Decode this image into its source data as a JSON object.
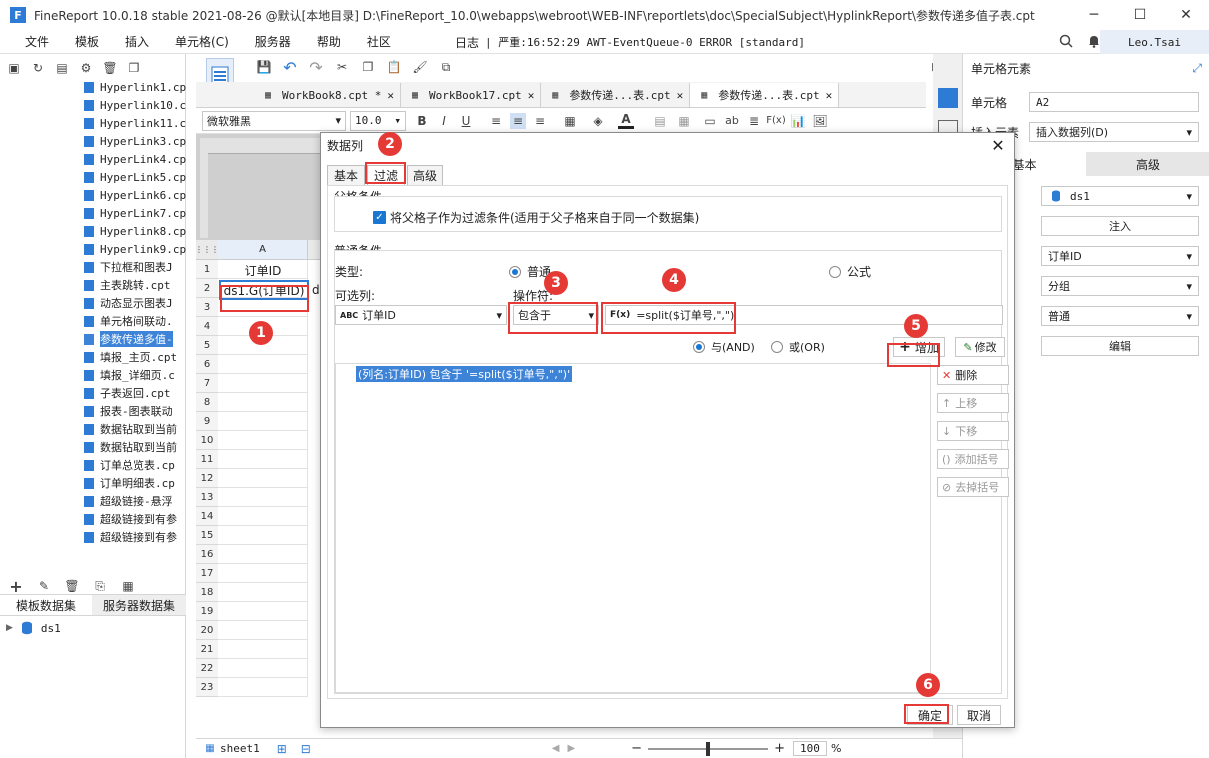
{
  "window": {
    "title": "FineReport 10.0.18 stable 2021-08-26 @默认[本地目录]     D:\\FineReport_10.0\\webapps\\webroot\\WEB-INF\\reportlets\\doc\\SpecialSubject\\HyplinkReport\\参数传递多值子表.cpt",
    "minimize": "─",
    "maximize": "☐",
    "close": "✕"
  },
  "menu": [
    "文件",
    "模板",
    "插入",
    "单元格(C)",
    "服务器",
    "帮助",
    "社区"
  ],
  "log": {
    "label": "日志",
    "text": "| 严重:16:52:29 AWT-EventQueue-0 ERROR [standard]"
  },
  "user": "Leo.Tsai",
  "left_panel": {
    "tree_items": [
      "Hyperlink1.cp",
      "Hyperlink10.c",
      "Hyperlink11.c",
      "HyperLink3.cp",
      "HyperLink4.cp",
      "HyperLink5.cp",
      "HyperLink6.cp",
      "HyperLink7.cp",
      "Hyperlink8.cp",
      "Hyperlink9.cp",
      "下拉框和图表J",
      "主表跳转.cpt",
      "动态显示图表J",
      "单元格间联动.",
      "参数传递多值-",
      "填报_主页.cpt",
      "填报_详细页.c",
      "子表返回.cpt",
      "报表-图表联动",
      "数据钻取到当前",
      "数据钻取到当前",
      "订单总览表.cp",
      "订单明细表.cp",
      "超级链接-悬浮",
      "超级链接到有参",
      "超级链接到有参"
    ],
    "selected_index": 14,
    "dataset_tabs": [
      "模板数据集",
      "服务器数据集"
    ],
    "dataset": "ds1"
  },
  "tabs": [
    "WorkBook8.cpt *",
    "WorkBook17.cpt",
    "参数传递...表.cpt",
    "参数传递...表.cpt"
  ],
  "format_bar": {
    "font": "微软雅黑",
    "size": "10.0"
  },
  "sheet": {
    "col_header": "A",
    "header_cell": "订单ID",
    "formula_cell": "ds1.G(订单ID)",
    "overflow_char": "d",
    "rows": [
      "1",
      "2",
      "3",
      "4",
      "5",
      "6",
      "7",
      "8",
      "9",
      "10",
      "11",
      "12",
      "13",
      "14",
      "15",
      "16",
      "17",
      "18",
      "19",
      "20",
      "21",
      "22",
      "23"
    ],
    "sheet_tab": "sheet1",
    "zoom": "100",
    "zoom_unit": "%",
    "zoom_minus": "−",
    "zoom_plus": "+"
  },
  "right_panel": {
    "title": "单元格元素",
    "cell_label": "单元格",
    "cell_value": "A2",
    "insert_label": "插入元素",
    "insert_value": "插入数据列(D)",
    "tab_basic": "基本",
    "tab_advanced": "高级",
    "dataset_value": "ds1",
    "inject_button": "注入",
    "column_value": "订单ID",
    "group_value": "分组",
    "normal_value": "普通",
    "edit_button": "编辑"
  },
  "dialog": {
    "title": "数据列",
    "close": "✕",
    "tabs": [
      "基本",
      "过滤",
      "高级"
    ],
    "parent_section": "父格条件",
    "parent_checkbox": "将父格子作为过滤条件(适用于父子格来自于同一个数据集)",
    "normal_section": "普通条件",
    "type_label": "类型:",
    "type_normal": "普通",
    "type_formula": "公式",
    "column_label": "可选列:",
    "column_value": "订单ID",
    "operator_label": "操作符:",
    "operator_value": "包含于",
    "formula_value": "=split($订单号,\",\")",
    "and_label": "与(AND)",
    "or_label": "或(OR)",
    "add_button": "增加",
    "modify_button": "修改",
    "condition_item": "(列名:订单ID) 包含于 '=split($订单号,\",\")'",
    "side_buttons": [
      "删除",
      "上移",
      "下移",
      "添加括号",
      "去掉括号"
    ],
    "ok_button": "确定",
    "cancel_button": "取消"
  },
  "badges": [
    "1",
    "2",
    "3",
    "4",
    "5",
    "6"
  ]
}
